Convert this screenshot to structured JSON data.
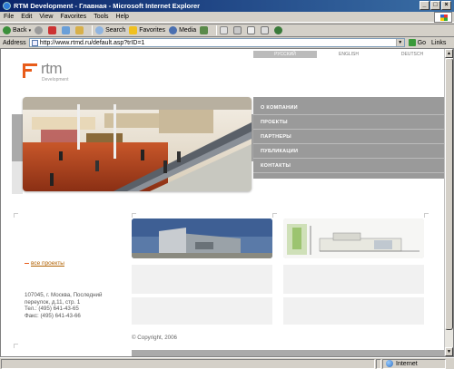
{
  "window": {
    "title": "RTM Development - Главная - Microsoft Internet Explorer",
    "minimize": "_",
    "maximize": "□",
    "close": "×"
  },
  "menu": [
    "File",
    "Edit",
    "View",
    "Favorites",
    "Tools",
    "Help"
  ],
  "toolbar": {
    "back": "Back",
    "search": "Search",
    "favorites": "Favorites",
    "media": "Media"
  },
  "address": {
    "label": "Address",
    "url": "http://www.rtmd.ru/default.asp?trID=1",
    "go": "Go",
    "links": "Links"
  },
  "site": {
    "languages": [
      "РУССКИЙ",
      "ENGLISH",
      "DEUTSCH"
    ],
    "logo": {
      "brand": "rtm",
      "sub": "Development"
    },
    "nav": [
      "О КОМПАНИИ",
      "ПРОЕКТЫ",
      "ПАРТНЕРЫ",
      "ПУБЛИКАЦИИ",
      "КОНТАКТЫ"
    ],
    "projects_link": "все проекты",
    "address_text": "107045, г. Москва, Последний\nпереулок, д.11, стр. 1\nТел.: (495) 641-43-65\nФакс: (495) 641-43-66",
    "copyright": "© Copyright, 2006",
    "accent_color": "#e85c1a"
  },
  "status": {
    "zone": "Internet"
  }
}
